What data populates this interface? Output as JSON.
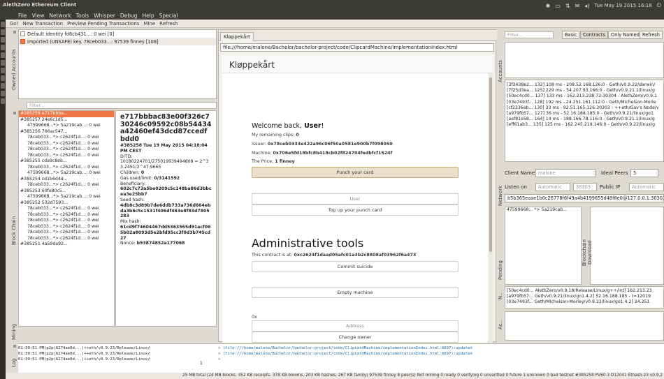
{
  "window": {
    "title": "AlethZero Ethereum Client"
  },
  "menu": [
    "File",
    "View",
    "Network",
    "Tools",
    "Whisper",
    "Debug",
    "Help",
    "Special"
  ],
  "tray": {
    "clock": "Tue May 19 2015 16:18"
  },
  "toolbar": [
    "Go!",
    "New Transaction",
    "Preview Pending Transactions",
    "Mine",
    "Refresh"
  ],
  "docks": {
    "accounts": "Owned Accounts",
    "blockchain": "Block Chain",
    "mining": "Mining",
    "log": "Log",
    "browser_accounts": "Accounts",
    "network": "Network",
    "blockchain_download": "Blockchain Download",
    "pending": "Pending",
    "n": "N..",
    "ac": "Ac.."
  },
  "accounts": [
    {
      "label": "Default identity fd6cb431...: 0 wei [0]",
      "checked": false
    },
    {
      "label": "Imported (UNSAFE) key. 78ceb033...: 97539 finney [108]",
      "checked": true
    }
  ],
  "filter_placeholder": "Filter...",
  "blocks": [
    {
      "t": "#385258 e717bbba...",
      "top": true,
      "sel": true
    },
    {
      "t": "#385257 24e6c1d5...",
      "top": true
    },
    {
      "t": "47599668...*> 5a219cab...: 0 wei",
      "top": false
    },
    {
      "t": "#385256 766ac547...",
      "top": true
    },
    {
      "t": "78ceb033...*> c2624f1d...: 0 wei",
      "top": false
    },
    {
      "t": "78ceb033...*> c2624f1d...: 0 wei",
      "top": false
    },
    {
      "t": "78ceb033...*> c2624f1d...: 0 wei",
      "top": false
    },
    {
      "t": "78ceb033...*> c2624f1d...: 0 wei",
      "top": false
    },
    {
      "t": "#385255 cda9c8eb...",
      "top": true
    },
    {
      "t": "78ceb033...*> c2624f1d...: 0 wei",
      "top": false
    },
    {
      "t": "47599668...*> 5a219cab...: 0 wei",
      "top": false
    },
    {
      "t": "#385254 cd1b6d4d...",
      "top": true
    },
    {
      "t": "78ceb033...*> c2624f1d...: 0 wei",
      "top": false
    },
    {
      "t": "#385253 60fe80c5...",
      "top": true
    },
    {
      "t": "47599668...*> 5a219cab...: 0 wei",
      "top": false
    },
    {
      "t": "#385252 532d7593...",
      "top": true
    },
    {
      "t": "78ceb033...*> c2624f1d...: 0 wei",
      "top": false
    },
    {
      "t": "78ceb033...*> c2624f1d...: 0 wei",
      "top": false
    },
    {
      "t": "78ceb033...*> c2624f1d...: 0 wei",
      "top": false
    },
    {
      "t": "78ceb033...*> c2624f1d...: 0 wei",
      "top": false
    },
    {
      "t": "78ceb033...*> c2624f1d...: 0 wei",
      "top": false
    },
    {
      "t": "78ceb033...*> c2624f1d...: 0 wei",
      "top": false
    },
    {
      "t": "#385251 4a59da92...",
      "top": true
    }
  ],
  "blockinfo": {
    "hash": "e717bbbac83e00f326c730246c09592c08b54434a42460ef43dcd87ccedfbdd0",
    "head": "#385258   Tue 19 May 2015 04:18:04 PM CEST",
    "dtd_label": "D/TD:",
    "dtd": "10180224701/275019939494808 = 2^33.2451/2^47.9665",
    "children_label": "Children:",
    "children": "0",
    "gas_label": "Gas used/limit:",
    "gas": "0/3141592",
    "beneficiary_label": "Beneficiary:",
    "beneficiary": "602c7c73a5be0209c5c148ba86d3bbcea3e25bb7",
    "seed_label": "Seed hash:",
    "seed": "4db8c3d89b7de6ddb733a736d664ebda3b6c5c1531f406df463e8f83d7805283",
    "mix_label": "Mix hash:",
    "mix": "61cd9f74604467dd5363565d91acf065b02a8093d5e2bfd95cc3f0d3b745cd27",
    "nonce_label": "Nonce:",
    "nonce": "b93874852a177068"
  },
  "browser": {
    "tab": "Kløppekårt",
    "url": "file:///home/malone/Bachelor/bachelor-project/code/ClipcardMachine/implementationIndex.html",
    "heading": "Kløppekårt",
    "welcome": "Welcome back, ",
    "user": "User",
    "welcome_end": "!",
    "clips": "My remaining clips: ",
    "clips_val": "0",
    "issuer": "Issuer: ",
    "issuer_val": "0x78ceb0333e422a96c06f50a0581e900b7f098050",
    "machine": "Machine: ",
    "machine_val": "0x706e5fd18bfc8b418cb02f824704fedbfcf1524f",
    "price": "The Price: ",
    "price_val": "1 finney",
    "punch": "Punch your card",
    "user_input": "User",
    "topup": "Top up your punch card",
    "admin": "Administrative tools",
    "contract": "This contract is at: ",
    "contract_val": "0xc2624f1daad05afc01a3b2c8808af03962f6a473",
    "suicide": "Commit suicide",
    "empty": "Empty machine",
    "ox1": "0x",
    "address1": "Address",
    "change_owner": "Change owner",
    "ox2": "0x",
    "address2": "Address"
  },
  "right": {
    "filter": "Filter...",
    "buttons": [
      "Basic",
      "Contracts",
      "Only Named",
      "Refresh"
    ],
    "peers": [
      "[3f3438e2... 132] 108 ms - 208.52.168.126:0 - Geth/v0.9.22/darwin/",
      "[7f25d3ea... 125] 229 ms - 54.207.93.166:0 - Geth/v0.9.21.1/linux/g",
      "[50ec4cd0... 137] 133 ms - 162.213.238.72:30304 - AlethZero/v0.9.1",
      "[03e7493f... 128] 192 ms - 24.251.161.112:0 - Geth/Michelson-Morle",
      "[cf2336eb... 130] 33 ms - 92.51.165.126:30303 - ++eth/Gav's Node/v",
      "[a979fb57... 127] 36 ms - 52.16.188.185:0 - Geth/v0.9.21/linux/go1.",
      "[aef81e58... 164] 14 ms - 188.166.78.116:0 - Geth/v0.9.21.1/linux/g",
      "[eff61ab3... 135] 125 ms - 162.245.219.146:0 - Geth/v0.9.22/linux/g"
    ],
    "client_name_label": "Client Name",
    "client_name": "malone",
    "ideal_peers_label": "Ideal Peers",
    "ideal_peers": "5",
    "listen_label": "Listen on",
    "listen": "Automatic",
    "port": "30303",
    "public_ip_label": "Public IP",
    "public_ip": "Automatic",
    "enode": "b5b365eaae1b0c26778f6f49a4b4199655d48f8e0@127.0.0.1:30303",
    "pending": "47599668... *> 5a219cab...",
    "nodes": [
      "[50ec4cd0... AlethZero/v0.9.18/Release/Linux/g++/int] 162.213.23",
      "[a979fb57... Geth/v0.9.21/linux/go1.4.2] 52.16.188.185 - (=12019",
      "[03e7493f... Geth/Michelson-Morley/v0.9.22/linux/go1.4.2] 24.251"
    ]
  },
  "log": {
    "rows": [
      "01:39:51 PM|p2p|6274ae0d...|++eth/v0.9.23/Release/Linux/",
      "01:39:51 PM|p2p|6274ae0d...|++eth/v0.9.23/Release/Linux/",
      "01:39:51 PM|p2p|6274ae0d...|++eth/v0.9.23/Release/Linux/"
    ],
    "console": [
      "> (file:///home/malone/Bachelor/bachelor-project/code/ClipcardMachine/implementationIndex.html:6697):updated",
      "> (file:///home/malone/Bachelor/bachelor-project/code/ClipcardMachine/implementationIndex.html:6697):updated",
      ">"
    ],
    "slider_val": "1"
  },
  "status": "25 MB total (24 MB blocks, 352 KB receipts, 378 KB blooms, 203 KB hashes, 267 KB family)  97539 finney  8 peer(s)  Not mining  0 ready 0 verifying 0 unverified 0 future 1 unknown 0 bad  testnet #385258  PV60.3 D12041 Ethash-23 v0.9.2",
  "colors": {
    "accent": "#f07746",
    "topbar": "#3c3b37",
    "console": "#1d6aa8"
  }
}
